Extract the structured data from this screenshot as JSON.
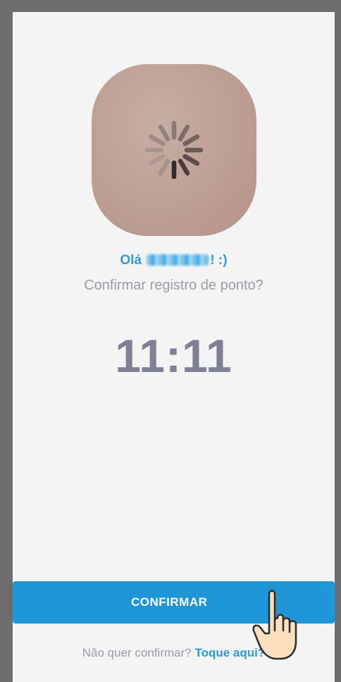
{
  "greeting": {
    "prefix": "Olá",
    "suffix": "! :)"
  },
  "question": "Confirmar registro de ponto?",
  "clock": "11:11",
  "confirm_button": {
    "label": "CONFIRMAR"
  },
  "footer": {
    "text": "Não quer confirmar?",
    "link": "Toque aqui?"
  },
  "colors": {
    "accent": "#1f96d8",
    "link": "#2a9bd7",
    "clock": "#7e8093",
    "muted_text": "#9a9ca4",
    "background": "#f4f4f5"
  },
  "icons": {
    "spinner": "loading-spinner-icon",
    "pointer": "pointing-hand-icon"
  }
}
